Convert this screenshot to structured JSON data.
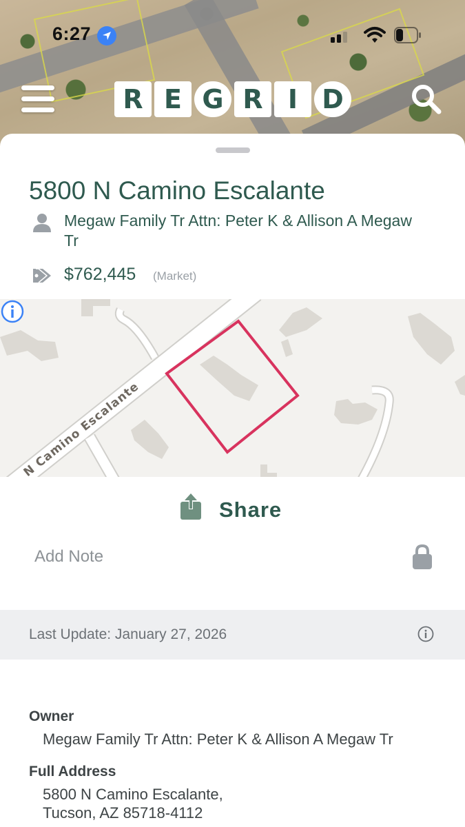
{
  "status_bar": {
    "time": "6:27"
  },
  "header": {
    "logo_letters": [
      "R",
      "E",
      "G",
      "R",
      "I",
      "D"
    ]
  },
  "parcel": {
    "address": "5800 N Camino Escalante",
    "owner_line1": "Megaw Family Tr Attn: Peter K & Allison A Megaw",
    "owner_line2": "Tr",
    "price": "$762,445",
    "price_note": "(Market)"
  },
  "map": {
    "street_label": "N Camino Escalante"
  },
  "actions": {
    "share_label": "Share",
    "add_note_label": "Add Note"
  },
  "last_update": "Last Update: January 27, 2026",
  "details": {
    "owner_label": "Owner",
    "owner_value": "Megaw Family Tr Attn: Peter K & Allison A Megaw Tr",
    "address_label": "Full Address",
    "address_line1": "5800 N Camino Escalante,",
    "address_line2": "Tucson, AZ 85718-4112"
  },
  "colors": {
    "brand_green": "#2f5a4f",
    "parcel_outline": "#d8335e",
    "link_blue": "#3b82f6"
  }
}
